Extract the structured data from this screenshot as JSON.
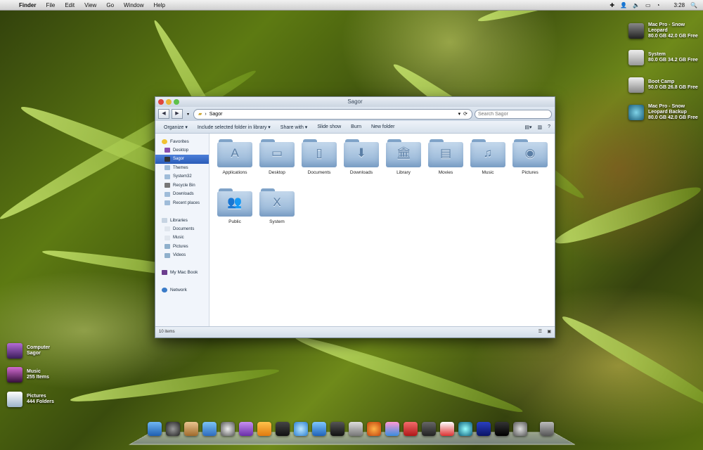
{
  "menubar": {
    "apple_icon": "apple-icon",
    "app_name": "Finder",
    "items": [
      "File",
      "Edit",
      "View",
      "Go",
      "Window",
      "Help"
    ],
    "clock": "3:28"
  },
  "desktop_right": [
    {
      "icon": "apple-drive-icon",
      "line1": "Mac Pro - Snow",
      "line2": "Leopard",
      "line3": "80.0 GB 42.0 GB Free"
    },
    {
      "icon": "hard-drive-icon",
      "line1": "System",
      "line2": "80.0 GB 34.2 GB Free",
      "line3": ""
    },
    {
      "icon": "boot-camp-drive-icon",
      "line1": "Boot Camp",
      "line2": "50.0 GB 26.8 GB Free",
      "line3": ""
    },
    {
      "icon": "time-machine-drive-icon",
      "line1": "Mac Pro - Snow",
      "line2": "Leopard Backup",
      "line3": "80.0 GB 42.0 GB Free"
    }
  ],
  "desktop_left": [
    {
      "icon": "computer-icon",
      "line1": "Computer",
      "line2": "Sagor"
    },
    {
      "icon": "music-folder-icon",
      "line1": "Music",
      "line2": "255 Items"
    },
    {
      "icon": "pictures-folder-icon",
      "line1": "Pictures",
      "line2": "444 Folders"
    }
  ],
  "window": {
    "title": "Sagor",
    "path": "Sagor",
    "search_placeholder": "Search Sagor",
    "toolbar": [
      "Organize ▾",
      "Include selected folder in library ▾",
      "Share with ▾",
      "Slide show",
      "Burn",
      "New folder"
    ],
    "sidebar": {
      "favorites": {
        "label": "Favorites",
        "items": [
          "Desktop",
          "Sagor",
          "Themes",
          "System32",
          "Recycle Bin",
          "Downloads",
          "Recent places"
        ]
      },
      "libraries": {
        "label": "Libraries",
        "items": [
          "Documents",
          "Music",
          "Pictures",
          "Videos"
        ]
      },
      "computer": {
        "label": "My Mac Book"
      },
      "network": {
        "label": "Network"
      }
    },
    "folders": [
      {
        "label": "Applications",
        "glyph": "A"
      },
      {
        "label": "Desktop",
        "glyph": "▭"
      },
      {
        "label": "Documents",
        "glyph": "▯"
      },
      {
        "label": "Downloads",
        "glyph": "⬇"
      },
      {
        "label": "Library",
        "glyph": "🏛"
      },
      {
        "label": "Movies",
        "glyph": "▤"
      },
      {
        "label": "Music",
        "glyph": "♫"
      },
      {
        "label": "Pictures",
        "glyph": "◉"
      },
      {
        "label": "Public",
        "glyph": "👥"
      },
      {
        "label": "System",
        "glyph": "X"
      }
    ],
    "status": "10 items"
  },
  "colors": {
    "accent": "#2a5cb8",
    "folder": "#9fbcd9"
  }
}
